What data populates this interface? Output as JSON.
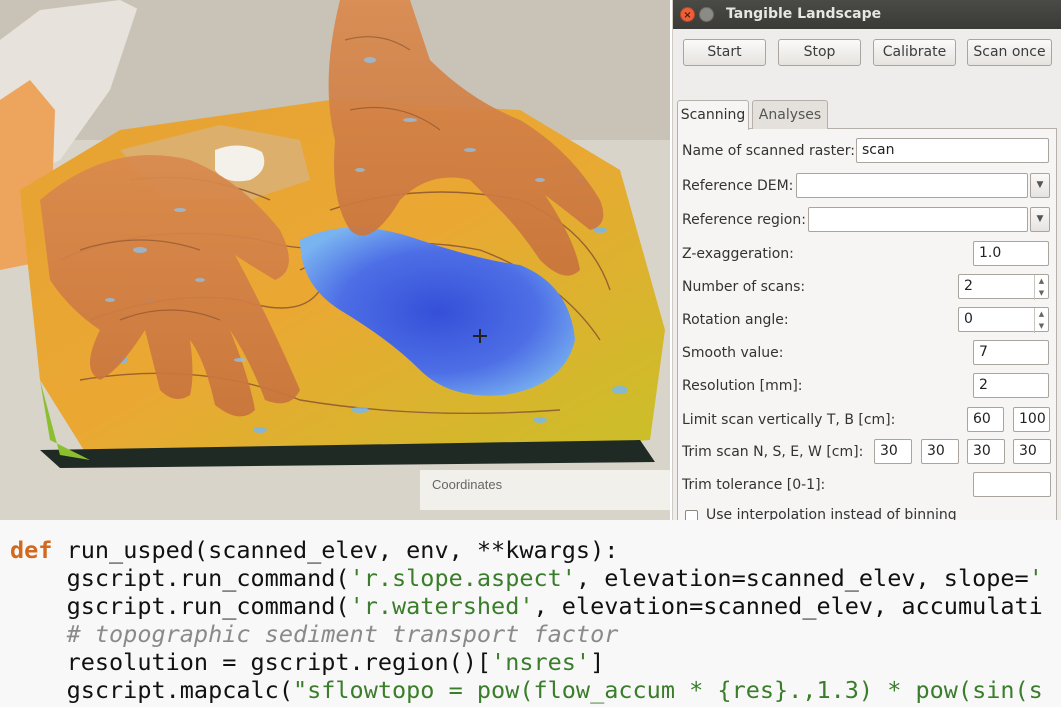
{
  "photo": {
    "label_text": "Coordinates"
  },
  "window": {
    "title": "Tangible Landscape",
    "buttons": {
      "start": "Start",
      "stop": "Stop",
      "calibrate": "Calibrate",
      "scan_once": "Scan once"
    },
    "tabs": [
      "Scanning",
      "Analyses"
    ],
    "fields": {
      "scanned_raster_label": "Name of scanned raster:",
      "scanned_raster_value": "scan",
      "reference_dem_label": "Reference DEM:",
      "reference_dem_value": "",
      "reference_region_label": "Reference region:",
      "reference_region_value": "",
      "z_exag_label": "Z-exaggeration:",
      "z_exag_value": "1.0",
      "num_scans_label": "Number of scans:",
      "num_scans_value": "2",
      "rotation_label": "Rotation angle:",
      "rotation_value": "0",
      "smooth_label": "Smooth value:",
      "smooth_value": "7",
      "resolution_label": "Resolution [mm]:",
      "resolution_value": "2",
      "limit_label": "Limit scan vertically T, B [cm]:",
      "limit_t": "60",
      "limit_b": "100",
      "trim_label": "Trim scan N, S, E, W [cm]:",
      "trim_n": "30",
      "trim_s": "30",
      "trim_e": "30",
      "trim_w": "30",
      "trim_tol_label": "Trim tolerance [0-1]:",
      "trim_tol_value": "",
      "interp_label": "Use interpolation instead of binning"
    }
  },
  "code": {
    "l1_kw": "def",
    "l1_rest": " run_usped(scanned_elev, env, **kwargs):",
    "l2_a": "    gscript.run_command(",
    "l2_str": "'r.slope.aspect'",
    "l2_b": ", elevation=scanned_elev, slope=",
    "l2_str2": "'",
    "l3_a": "    gscript.run_command(",
    "l3_str": "'r.watershed'",
    "l3_b": ", elevation=scanned_elev, accumulati",
    "l4_cm": "    # topographic sediment transport factor",
    "l5_a": "    resolution = gscript.region()[",
    "l5_str": "'nsres'",
    "l5_b": "]",
    "l6_a": "    gscript.mapcalc(",
    "l6_str": "\"sflowtopo = pow(flow_accum * {res}.,1.3) * pow(sin(s"
  }
}
